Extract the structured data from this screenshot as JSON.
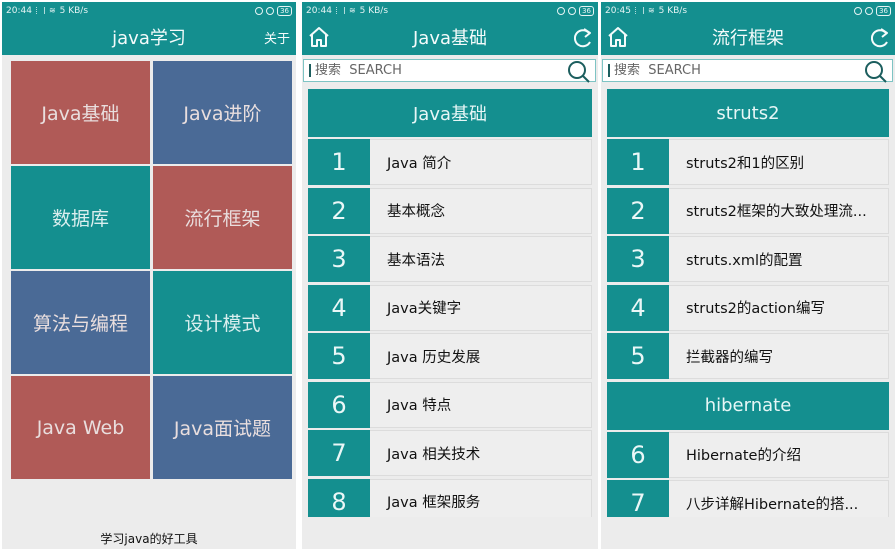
{
  "colors": {
    "primary": "#148f8f",
    "tile_red": "#b05a57",
    "tile_blue": "#4a6a96",
    "background": "#ececec"
  },
  "screens": [
    {
      "status": {
        "time": "20:44",
        "speed": "5 KB/s",
        "battery": "36"
      },
      "appbar": {
        "title": "java学习",
        "about_label": "关于"
      },
      "tiles": [
        {
          "label": "Java基础",
          "color": "red"
        },
        {
          "label": "Java进阶",
          "color": "blue"
        },
        {
          "label": "数据库",
          "color": "teal"
        },
        {
          "label": "流行框架",
          "color": "red"
        },
        {
          "label": "算法与编程",
          "color": "blue"
        },
        {
          "label": "设计模式",
          "color": "teal"
        },
        {
          "label": "Java Web",
          "color": "red"
        },
        {
          "label": "Java面试题",
          "color": "blue"
        }
      ],
      "footer": "学习java的好工具"
    },
    {
      "status": {
        "time": "20:44",
        "speed": "5 KB/s",
        "battery": "36"
      },
      "appbar": {
        "title": "Java基础",
        "home_icon": "home-icon",
        "refresh_icon": "refresh-icon"
      },
      "search": {
        "placeholder": "搜索  SEARCH"
      },
      "sections": [
        {
          "header": "Java基础",
          "items": [
            {
              "num": "1",
              "label": "Java 简介"
            },
            {
              "num": "2",
              "label": "基本概念"
            },
            {
              "num": "3",
              "label": "基本语法"
            },
            {
              "num": "4",
              "label": "Java关键字"
            },
            {
              "num": "5",
              "label": "Java 历史发展"
            },
            {
              "num": "6",
              "label": "Java 特点"
            },
            {
              "num": "7",
              "label": "Java 相关技术"
            },
            {
              "num": "8",
              "label": "Java 框架服务"
            }
          ]
        }
      ]
    },
    {
      "status": {
        "time": "20:45",
        "speed": "5 KB/s",
        "battery": "36"
      },
      "appbar": {
        "title": "流行框架",
        "home_icon": "home-icon",
        "refresh_icon": "refresh-icon"
      },
      "search": {
        "placeholder": "搜索  SEARCH"
      },
      "sections": [
        {
          "header": "struts2",
          "items": [
            {
              "num": "1",
              "label": "struts2和1的区别"
            },
            {
              "num": "2",
              "label": "struts2框架的大致处理流..."
            },
            {
              "num": "3",
              "label": "struts.xml的配置"
            },
            {
              "num": "4",
              "label": "struts2的action编写"
            },
            {
              "num": "5",
              "label": "拦截器的编写"
            }
          ]
        },
        {
          "header": "hibernate",
          "items": [
            {
              "num": "6",
              "label": "Hibernate的介绍"
            },
            {
              "num": "7",
              "label": "八步详解Hibernate的搭..."
            }
          ]
        }
      ]
    }
  ]
}
